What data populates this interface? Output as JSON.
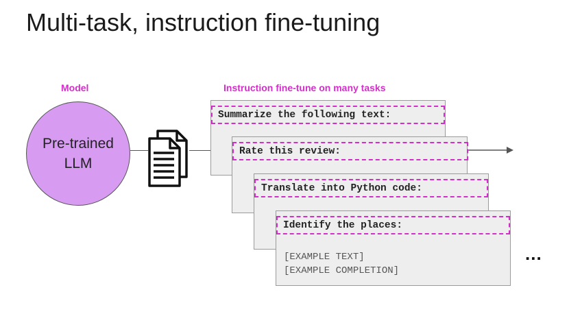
{
  "title": "Multi-task, instruction fine-tuning",
  "labels": {
    "model": "Model",
    "tasks": "Instruction fine-tune on many tasks"
  },
  "model": {
    "line1": "Pre-trained",
    "line2": "LLM"
  },
  "tasks": [
    {
      "instruction": "Summarize the following text:"
    },
    {
      "instruction": "Rate this review:"
    },
    {
      "instruction": "Translate into Python code:"
    },
    {
      "instruction": "Identify the places:",
      "example_text": "[EXAMPLE TEXT]",
      "example_completion": "[EXAMPLE COMPLETION]"
    }
  ],
  "ellipsis": "...",
  "colors": {
    "accent": "#d12fc8",
    "model_fill": "#d79cf2",
    "card_fill": "#eeeeee"
  },
  "icons": {
    "documents": "documents-icon",
    "arrow": "arrow-right-icon"
  }
}
